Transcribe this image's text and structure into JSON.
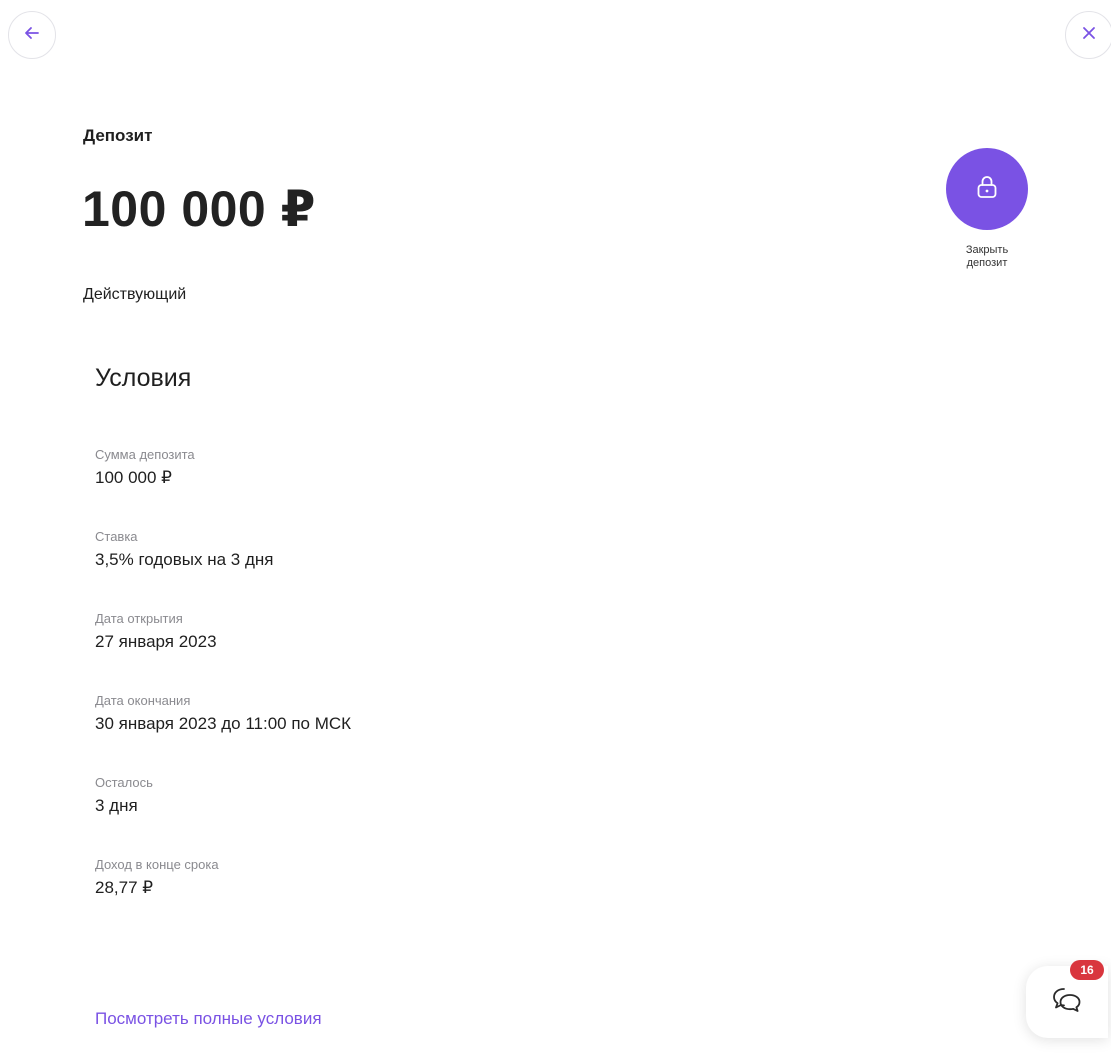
{
  "header": {
    "back_icon": "arrow-left-icon",
    "close_icon": "close-icon",
    "accent_color": "#7a52e4"
  },
  "deposit": {
    "type_label": "Депозит",
    "amount": "100 000 ₽",
    "status": "Действующий"
  },
  "action": {
    "icon": "lock-icon",
    "label": "Закрыть депозит"
  },
  "conditions": {
    "title": "Условия",
    "items": [
      {
        "label": "Сумма депозита",
        "value": "100 000 ₽"
      },
      {
        "label": "Ставка",
        "value": "3,5% годовых на 3 дня"
      },
      {
        "label": "Дата открытия",
        "value": "27 января 2023"
      },
      {
        "label": "Дата окончания",
        "value": "30 января 2023 до 11:00 по МСК"
      },
      {
        "label": "Осталось",
        "value": "3 дня"
      },
      {
        "label": "Доход в конце срока",
        "value": "28,77 ₽"
      }
    ],
    "full_terms_link": "Посмотреть полные условия"
  },
  "chat": {
    "icon": "chat-bubbles-icon",
    "badge_count": "16",
    "badge_color": "#d9363e"
  }
}
